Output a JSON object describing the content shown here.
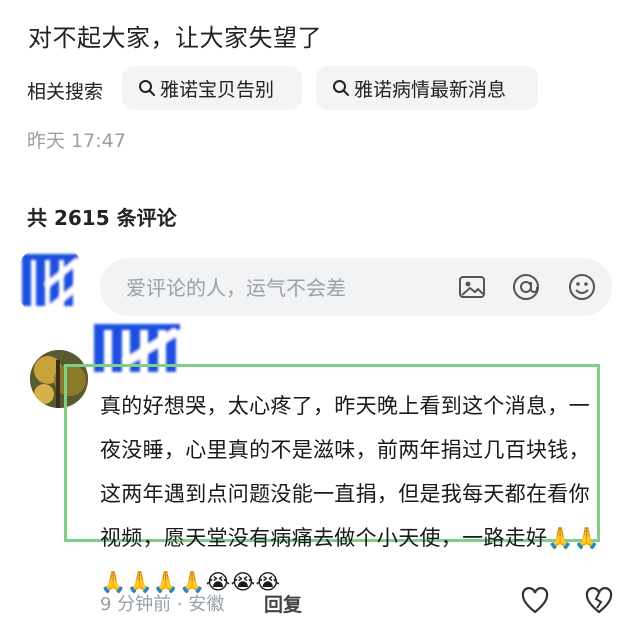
{
  "post": {
    "title": "对不起大家，让大家失望了",
    "time": "昨天 17:47"
  },
  "related": {
    "label": "相关搜索",
    "chips": [
      "雅诺宝贝告别",
      "雅诺病情最新消息"
    ]
  },
  "comments_header": {
    "count_text": "共 2615 条评论"
  },
  "composer": {
    "placeholder": "爱评论的人，运气不会差",
    "icons": [
      "image-icon",
      "at-icon",
      "emoji-icon"
    ]
  },
  "comment": {
    "text": "真的好想哭，太心疼了，昨天晚上看到这个消息，一夜没睡，心里真的不是滋味，前两年捐过几百块钱，这两年遇到点问题没能一直捐，但是我每天都在看你视频，愿天堂没有病痛去做个小天使，一路走好",
    "emojis": "🙏🙏🙏🙏🙏🙏😭😭😭",
    "meta": "9 分钟前 · 安徽",
    "reply_label": "回复"
  },
  "colors": {
    "highlight": "#7fcf87",
    "logo_blue": "#1f4fe0"
  }
}
